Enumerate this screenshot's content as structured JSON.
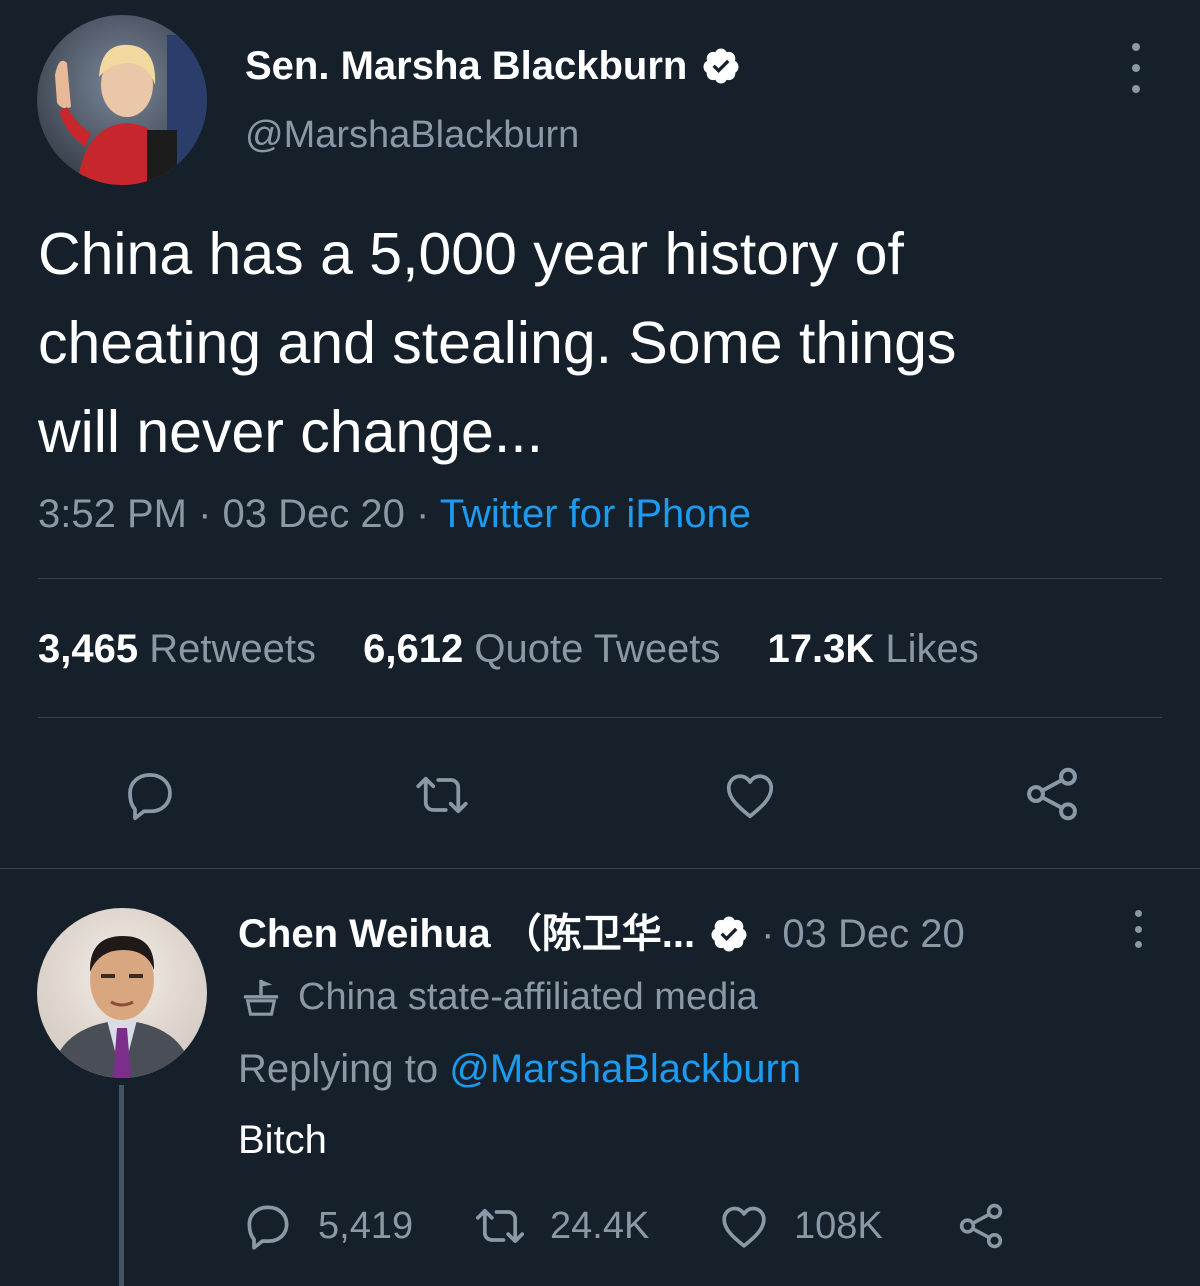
{
  "main_tweet": {
    "display_name": "Sen. Marsha Blackburn",
    "handle": "@MarshaBlackburn",
    "text_lines": [
      "China has a 5,000 year history of",
      "cheating and stealing. Some things",
      "will never change..."
    ],
    "time": "3:52 PM",
    "date": "03 Dec 20",
    "separator": "·",
    "source": "Twitter for iPhone",
    "stats": {
      "retweets_count": "3,465",
      "retweets_label": "Retweets",
      "quotes_count": "6,612",
      "quotes_label": "Quote Tweets",
      "likes_count": "17.3K",
      "likes_label": "Likes"
    },
    "actions": [
      "reply-icon",
      "retweet-icon",
      "like-icon",
      "share-icon"
    ]
  },
  "reply_tweet": {
    "display_name": "Chen Weihua （陈卫华...",
    "separator": "·",
    "date": "03 Dec 20",
    "affiliation": "China state-affiliated media",
    "replying_prefix": "Replying to",
    "replying_to": "@MarshaBlackburn",
    "text": "Bitch",
    "counts": {
      "replies": "5,419",
      "retweets": "24.4K",
      "likes": "108K"
    }
  },
  "colors": {
    "background": "#15202b",
    "primary_text": "#ffffff",
    "secondary_text": "#8b98a5",
    "link": "#1d9bf0",
    "divider": "#38444d"
  }
}
